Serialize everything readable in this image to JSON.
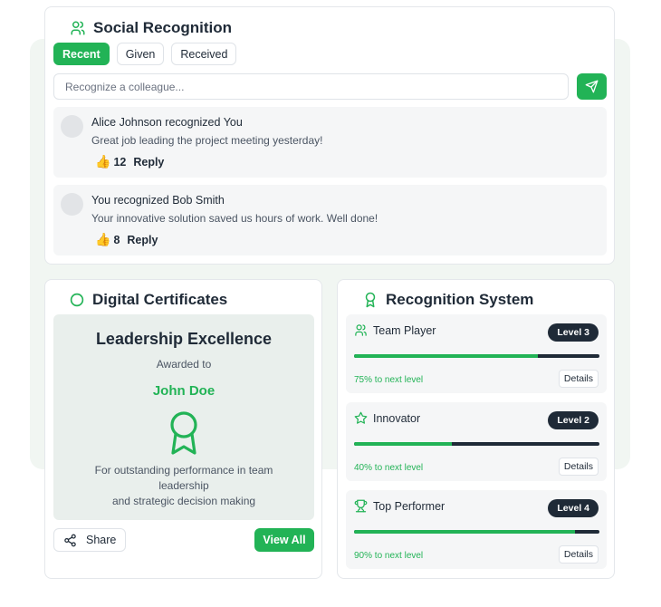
{
  "social": {
    "title": "Social Recognition",
    "tabs": [
      "Recent",
      "Given",
      "Received"
    ],
    "active_tab": "Recent",
    "search_placeholder": "Recognize a colleague...",
    "posts": [
      {
        "header": "Alice Johnson recognized You",
        "message": "Great job leading the project meeting yesterday!",
        "likes": "12",
        "reply_label": "Reply"
      },
      {
        "header": "You recognized Bob Smith",
        "message": "Your innovative solution saved us hours of work. Well done!",
        "likes": "8",
        "reply_label": "Reply"
      }
    ]
  },
  "certificates": {
    "title": "Digital Certificates",
    "cert_title": "Leadership Excellence",
    "awarded_to_label": "Awarded to",
    "recipient": "John Doe",
    "description_line1": "For outstanding performance in team leadership",
    "description_line2": "and strategic decision making",
    "share_label": "Share",
    "view_all_label": "View All"
  },
  "recognition_system": {
    "title": "Recognition System",
    "items": [
      {
        "name": "Team Player",
        "icon": "users-icon",
        "level": "Level 3",
        "progress": 0.75,
        "next_label": "75% to next level",
        "details_label": "Details"
      },
      {
        "name": "Innovator",
        "icon": "star-icon",
        "level": "Level 2",
        "progress": 0.4,
        "next_label": "40% to next level",
        "details_label": "Details"
      },
      {
        "name": "Top Performer",
        "icon": "trophy-icon",
        "level": "Level 4",
        "progress": 0.9,
        "next_label": "90% to next level",
        "details_label": "Details"
      }
    ]
  },
  "colors": {
    "accent": "#22b356",
    "dark": "#1f2a37",
    "muted_bg": "#f5f6f7"
  }
}
